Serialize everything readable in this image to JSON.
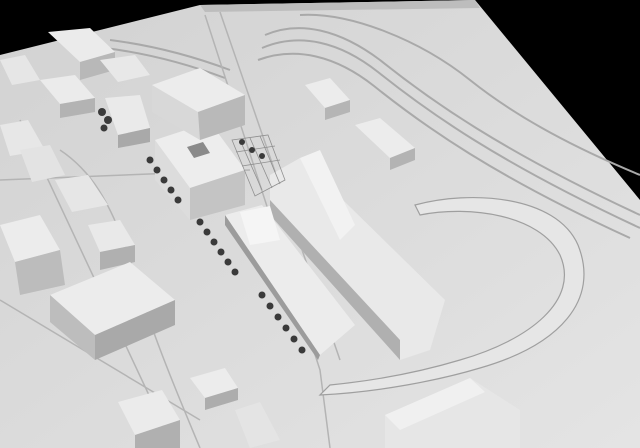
{
  "image": {
    "subject": "architectural-model-photo",
    "material": "white-card",
    "colors": {
      "background": "#000000",
      "base": "#d9d9d9",
      "base_dark": "#c8c8c8",
      "top": "#e8e8e8",
      "side_light": "#cfcfcf",
      "side_dark": "#9a9a9a",
      "line": "#a8a8a8",
      "tree": "#3a3a3a"
    }
  }
}
